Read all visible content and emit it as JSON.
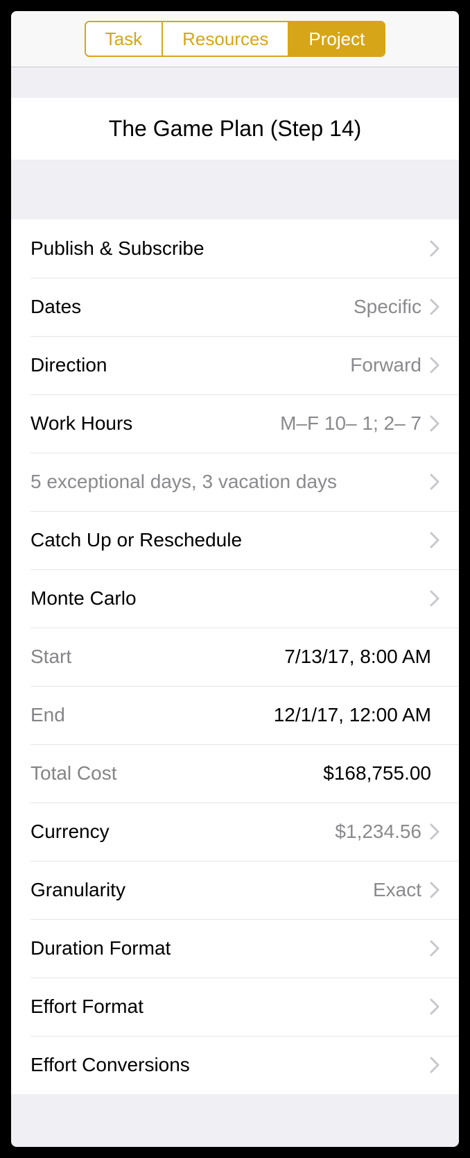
{
  "tabs": {
    "task": "Task",
    "resources": "Resources",
    "project": "Project"
  },
  "title": "The Game Plan (Step 14)",
  "rows": {
    "publish_subscribe": {
      "label": "Publish & Subscribe"
    },
    "dates": {
      "label": "Dates",
      "value": "Specific"
    },
    "direction": {
      "label": "Direction",
      "value": "Forward"
    },
    "work_hours": {
      "label": "Work Hours",
      "value": "M–F 10– 1; 2– 7"
    },
    "exceptions": {
      "label": "5 exceptional days, 3 vacation days"
    },
    "catch_up": {
      "label": "Catch Up or Reschedule"
    },
    "monte_carlo": {
      "label": "Monte Carlo"
    },
    "start": {
      "label": "Start",
      "value": "7/13/17, 8:00 AM"
    },
    "end": {
      "label": "End",
      "value": "12/1/17, 12:00 AM"
    },
    "total_cost": {
      "label": "Total Cost",
      "value": "$168,755.00"
    },
    "currency": {
      "label": "Currency",
      "value": "$1,234.56"
    },
    "granularity": {
      "label": "Granularity",
      "value": "Exact"
    },
    "duration_format": {
      "label": "Duration Format"
    },
    "effort_format": {
      "label": "Effort Format"
    },
    "effort_conversions": {
      "label": "Effort Conversions"
    }
  }
}
